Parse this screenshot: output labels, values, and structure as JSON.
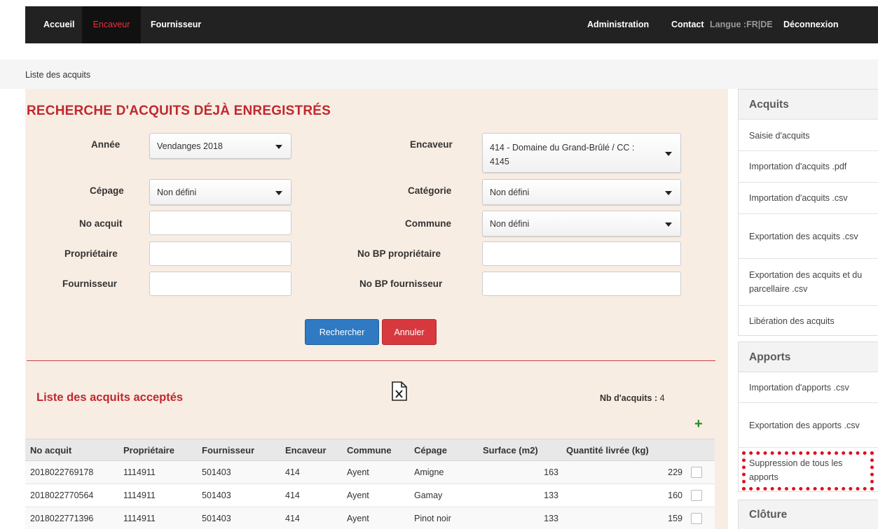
{
  "nav": {
    "left": [
      "Accueil",
      "Encaveur",
      "Fournisseur"
    ],
    "right": [
      "Administration",
      "Contact",
      "Langue :FR|DE",
      "Déconnexion"
    ]
  },
  "breadcrumb": "Liste des acquits",
  "title": "RECHERCHE D'ACQUITS DÉJÀ ENREGISTRÉS",
  "form": {
    "annee": {
      "label": "Année",
      "value": "Vendanges 2018"
    },
    "encaveur": {
      "label": "Encaveur",
      "value_line1": "414 - Domaine du Grand-Brûlé / CC :",
      "value_line2": "4145"
    },
    "cepage": {
      "label": "Cépage",
      "value": "Non défini"
    },
    "categorie": {
      "label": "Catégorie",
      "value": "Non défini"
    },
    "no_acquit": {
      "label": "No acquit",
      "value": ""
    },
    "commune": {
      "label": "Commune",
      "value": "Non défini"
    },
    "proprietaire": {
      "label": "Propriétaire",
      "value": ""
    },
    "no_bp_proprietaire": {
      "label": "No BP propriétaire",
      "value": ""
    },
    "fournisseur": {
      "label": "Fournisseur",
      "value": ""
    },
    "no_bp_fournisseur": {
      "label": "No BP fournisseur",
      "value": ""
    },
    "search_label": "Rechercher",
    "cancel_label": "Annuler"
  },
  "list": {
    "title": "Liste des acquits acceptés",
    "count_label": "Nb d'acquits :",
    "count": "4",
    "columns": [
      "No acquit",
      "Propriétaire",
      "Fournisseur",
      "Encaveur",
      "Commune",
      "Cépage",
      "Surface (m2)",
      "Quantité livrée (kg)"
    ],
    "rows": [
      [
        "2018022769178",
        "1114911",
        "501403",
        "414",
        "Ayent",
        "Amigne",
        "163",
        "229"
      ],
      [
        "2018022770564",
        "1114911",
        "501403",
        "414",
        "Ayent",
        "Gamay",
        "133",
        "160"
      ],
      [
        "2018022771396",
        "1114911",
        "501403",
        "414",
        "Ayent",
        "Pinot noir",
        "133",
        "159"
      ]
    ]
  },
  "sidebar": {
    "acquits": {
      "title": "Acquits",
      "items": [
        "Saisie d'acquits",
        "Importation d'acquits .pdf",
        "Importation d'acquits .csv",
        "Exportation des acquits .csv",
        "Exportation des acquits et du parcellaire .csv",
        "Libération des acquits"
      ]
    },
    "apports": {
      "title": "Apports",
      "items": [
        "Importation d'apports .csv",
        "Exportation des apports .csv",
        "Suppression de tous les apports"
      ]
    },
    "cloture": {
      "title": "Clôture"
    }
  }
}
